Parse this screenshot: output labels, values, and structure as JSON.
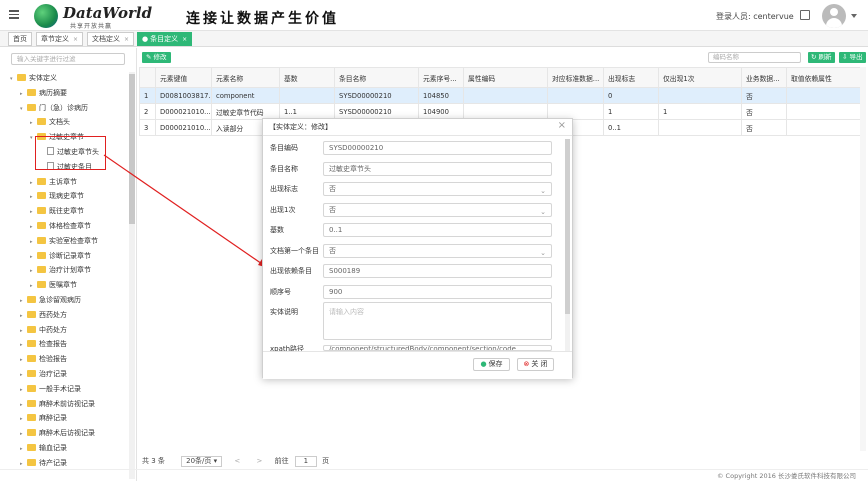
{
  "header": {
    "logo_text": "DataWorld",
    "logo_sub": "共享开放共赢",
    "slogan": "连接让数据产生价值",
    "user_label": "登录人员: centervue"
  },
  "tabs": [
    {
      "label": "首页"
    },
    {
      "label": "章节定义",
      "close": "×"
    },
    {
      "label": "文档定义",
      "close": "×"
    },
    {
      "label": "条目定义",
      "close": "×"
    }
  ],
  "sidebar": {
    "search_placeholder": "输入关键字进行过滤",
    "tree": [
      {
        "label": "实体定义",
        "tri": "▾",
        "icon": "folder"
      },
      {
        "label": "病历摘要",
        "tri": "▸",
        "icon": "folder"
      },
      {
        "label": "门（急）诊病历",
        "tri": "▾",
        "icon": "folder"
      },
      {
        "label": "文档头",
        "tri": "▸",
        "icon": "folder"
      },
      {
        "label": "过敏史章节",
        "tri": "▾",
        "icon": "folder"
      },
      {
        "label": "过敏史章节头",
        "tri": "",
        "icon": "doc"
      },
      {
        "label": "过敏史条目",
        "tri": "",
        "icon": "doc"
      },
      {
        "label": "主诉章节",
        "tri": "▸",
        "icon": "folder"
      },
      {
        "label": "现病史章节",
        "tri": "▸",
        "icon": "folder"
      },
      {
        "label": "既往史章节",
        "tri": "▸",
        "icon": "folder"
      },
      {
        "label": "体格检查章节",
        "tri": "▸",
        "icon": "folder"
      },
      {
        "label": "实验室检查章节",
        "tri": "▸",
        "icon": "folder"
      },
      {
        "label": "诊断记录章节",
        "tri": "▸",
        "icon": "folder"
      },
      {
        "label": "治疗计划章节",
        "tri": "▸",
        "icon": "folder"
      },
      {
        "label": "医嘱章节",
        "tri": "▸",
        "icon": "folder"
      },
      {
        "label": "急诊留观病历",
        "tri": "▸",
        "icon": "folder"
      },
      {
        "label": "西药处方",
        "tri": "▸",
        "icon": "folder"
      },
      {
        "label": "中药处方",
        "tri": "▸",
        "icon": "folder"
      },
      {
        "label": "检查报告",
        "tri": "▸",
        "icon": "folder"
      },
      {
        "label": "检验报告",
        "tri": "▸",
        "icon": "folder"
      },
      {
        "label": "治疗记录",
        "tri": "▸",
        "icon": "folder"
      },
      {
        "label": "一般手术记录",
        "tri": "▸",
        "icon": "folder"
      },
      {
        "label": "麻醉术前访视记录",
        "tri": "▸",
        "icon": "folder"
      },
      {
        "label": "麻醉记录",
        "tri": "▸",
        "icon": "folder"
      },
      {
        "label": "麻醉术后访视记录",
        "tri": "▸",
        "icon": "folder"
      },
      {
        "label": "输血记录",
        "tri": "▸",
        "icon": "folder"
      },
      {
        "label": "待产记录",
        "tri": "▸",
        "icon": "folder"
      }
    ]
  },
  "toolbar": {
    "edit_label": "修改",
    "code_search_placeholder": "编码名称",
    "refresh_label": "刷新",
    "export_label": "导出"
  },
  "table": {
    "headers": [
      "",
      "元素键值",
      "元素名称",
      "基数",
      "条目名称",
      "元素序号...",
      "属性编码",
      "对应标准数据...",
      "出现标志",
      "仅出现1次",
      "业务数据...",
      "取值依赖属性"
    ],
    "rows": [
      [
        "1",
        "D0081003817...",
        "component",
        "",
        "SYSD00000210",
        "104850",
        "",
        "",
        "0",
        "",
        "否",
        ""
      ],
      [
        "2",
        "D000021010...",
        "过敏史章节代码",
        "1..1",
        "SYSD00000210",
        "104900",
        "",
        "",
        "1",
        "1",
        "否",
        ""
      ],
      [
        "3",
        "D000021010...",
        "入读部分",
        "",
        "",
        "",
        "",
        "",
        "0..1",
        "",
        "否",
        ""
      ]
    ]
  },
  "pager": {
    "total": "共 3 条",
    "page_size": "20条/页",
    "prev": "<",
    "next": ">",
    "goto_label": "前往",
    "page": "1",
    "page_suffix": "页"
  },
  "footer": {
    "copyright": "© Copyright 2016 长沙娄氏软件科技有限公司"
  },
  "modal": {
    "title": "【实体定义：修改】",
    "close": "×",
    "fields": [
      {
        "label": "条目编码",
        "value": "SYSD00000210"
      },
      {
        "label": "条目名称",
        "value": "过敏史章节头"
      },
      {
        "label": "出现标志",
        "value": "否",
        "select": true
      },
      {
        "label": "出现1次",
        "value": "否",
        "select": true
      },
      {
        "label": "基数",
        "value": "0..1"
      },
      {
        "label": "文档第一个条目",
        "value": "否",
        "select": true
      },
      {
        "label": "出现依赖条目",
        "value": "S000189"
      },
      {
        "label": "顺序号",
        "value": "900"
      }
    ],
    "desc_label": "实体说明",
    "desc_placeholder": "请输入内容",
    "xpath_label": "xpath路径",
    "xpath_value": "/component/structuredBody/component/section/code",
    "save_label": "保存",
    "close_label": "关 闭"
  }
}
